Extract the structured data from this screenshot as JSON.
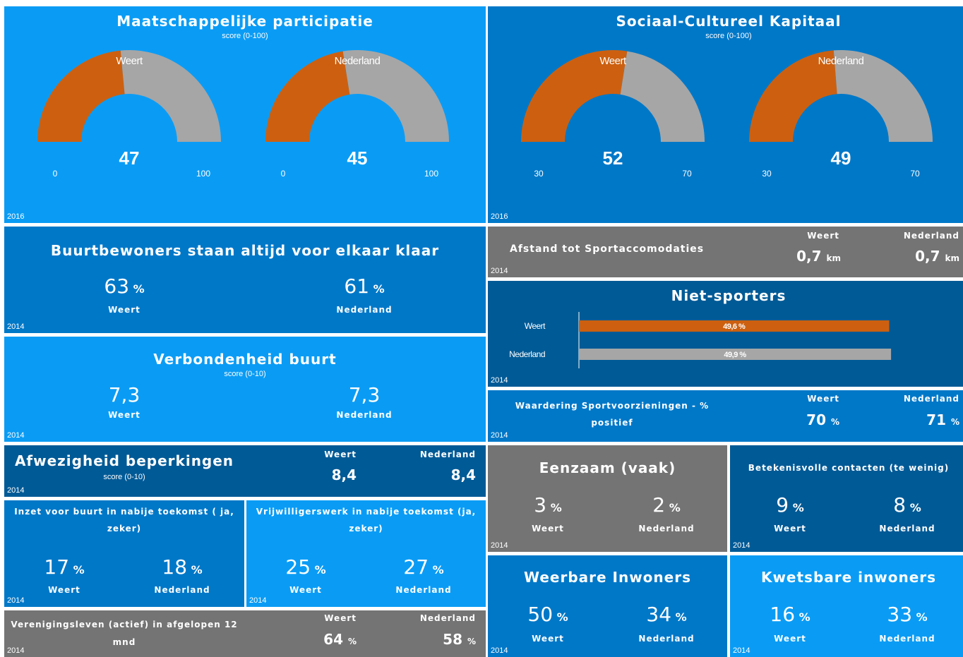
{
  "colors": {
    "weert": "#cc6010",
    "nederland": "#a6a6a6",
    "light": "#0a9cf5",
    "mid": "#0078c8",
    "dark": "#005a96",
    "grey": "#747474"
  },
  "participatie": {
    "title": "Maatschappelijke participatie",
    "subtitle": "score (0-100)",
    "year": "2016",
    "gauges": [
      {
        "label": "Weert",
        "value": 47,
        "value_text": "47",
        "min": 0,
        "max": 100,
        "min_text": "0",
        "max_text": "100"
      },
      {
        "label": "Nederland",
        "value": 45,
        "value_text": "45",
        "min": 0,
        "max": 100,
        "min_text": "0",
        "max_text": "100"
      }
    ]
  },
  "kapitaal": {
    "title": "Sociaal-Cultureel Kapitaal",
    "subtitle": "score (0-100)",
    "year": "2016",
    "gauges": [
      {
        "label": "Weert",
        "value": 52,
        "value_text": "52",
        "min": 30,
        "max": 70,
        "min_text": "30",
        "max_text": "70"
      },
      {
        "label": "Nederland",
        "value": 49,
        "value_text": "49",
        "min": 30,
        "max": 70,
        "min_text": "30",
        "max_text": "70"
      }
    ]
  },
  "buurtbewoners": {
    "title": "Buurtbewoners staan altijd voor elkaar klaar",
    "year": "2014",
    "weert": {
      "value": "63",
      "unit": "%",
      "label": "Weert"
    },
    "nederland": {
      "value": "61",
      "unit": "%",
      "label": "Nederland"
    }
  },
  "verbondenheid": {
    "title": "Verbondenheid buurt",
    "subtitle": "score (0-10)",
    "year": "2014",
    "weert": {
      "value": "7,3",
      "label": "Weert"
    },
    "nederland": {
      "value": "7,3",
      "label": "Nederland"
    }
  },
  "afwezigheid": {
    "title": "Afwezigheid beperkingen",
    "subtitle": "score (0-10)",
    "year": "2014",
    "weert": {
      "value": "8,4",
      "label": "Weert"
    },
    "nederland": {
      "value": "8,4",
      "label": "Nederland"
    }
  },
  "inzet": {
    "title_line1": "Inzet voor buurt in nabije toekomst ( ja,",
    "title_line2": "zeker)",
    "year": "2014",
    "weert": {
      "value": "17",
      "unit": "%",
      "label": "Weert"
    },
    "nederland": {
      "value": "18",
      "unit": "%",
      "label": "Nederland"
    }
  },
  "vrijwilligers": {
    "title_line1": "Vrijwilligerswerk in nabije toekomst (ja,",
    "title_line2": "zeker)",
    "year": "2014",
    "weert": {
      "value": "25",
      "unit": "%",
      "label": "Weert"
    },
    "nederland": {
      "value": "27",
      "unit": "%",
      "label": "Nederland"
    }
  },
  "verenigingsleven": {
    "title_line1": "Verenigingsleven (actief) in afgelopen 12",
    "title_line2": "mnd",
    "year": "2014",
    "weert": {
      "value": "64",
      "unit": "%",
      "label": "Weert"
    },
    "nederland": {
      "value": "58",
      "unit": "%",
      "label": "Nederland"
    }
  },
  "afstand": {
    "title": "Afstand tot Sportaccomodaties",
    "year": "2014",
    "weert": {
      "value": "0,7",
      "unit": "km",
      "label": "Weert"
    },
    "nederland": {
      "value": "0,7",
      "unit": "km",
      "label": "Nederland"
    }
  },
  "nietsporters": {
    "title": "Niet-sporters",
    "year": "2014",
    "chart_data": {
      "type": "bar",
      "categories": [
        "Weert",
        "Nederland"
      ],
      "values": [
        49.6,
        49.9
      ],
      "value_labels": [
        "49,6 %",
        "49,9 %"
      ],
      "xlim": [
        0,
        100
      ]
    }
  },
  "waardering": {
    "title_line1": "Waardering Sportvoorzieningen - %",
    "title_line2": "positief",
    "year": "2014",
    "weert": {
      "value": "70",
      "unit": "%",
      "label": "Weert"
    },
    "nederland": {
      "value": "71",
      "unit": "%",
      "label": "Nederland"
    }
  },
  "eenzaam": {
    "title": "Eenzaam (vaak)",
    "year": "2014",
    "weert": {
      "value": "3",
      "unit": "%",
      "label": "Weert"
    },
    "nederland": {
      "value": "2",
      "unit": "%",
      "label": "Nederland"
    }
  },
  "contacten": {
    "title": "Betekenisvolle contacten (te weinig)",
    "year": "2014",
    "weert": {
      "value": "9",
      "unit": "%",
      "label": "Weert"
    },
    "nederland": {
      "value": "8",
      "unit": "%",
      "label": "Nederland"
    }
  },
  "weerbare": {
    "title": "Weerbare Inwoners",
    "year": "2014",
    "weert": {
      "value": "50",
      "unit": "%",
      "label": "Weert"
    },
    "nederland": {
      "value": "34",
      "unit": "%",
      "label": "Nederland"
    }
  },
  "kwetsbare": {
    "title": "Kwetsbare inwoners",
    "year": "2014",
    "weert": {
      "value": "16",
      "unit": "%",
      "label": "Weert"
    },
    "nederland": {
      "value": "33",
      "unit": "%",
      "label": "Nederland"
    }
  }
}
